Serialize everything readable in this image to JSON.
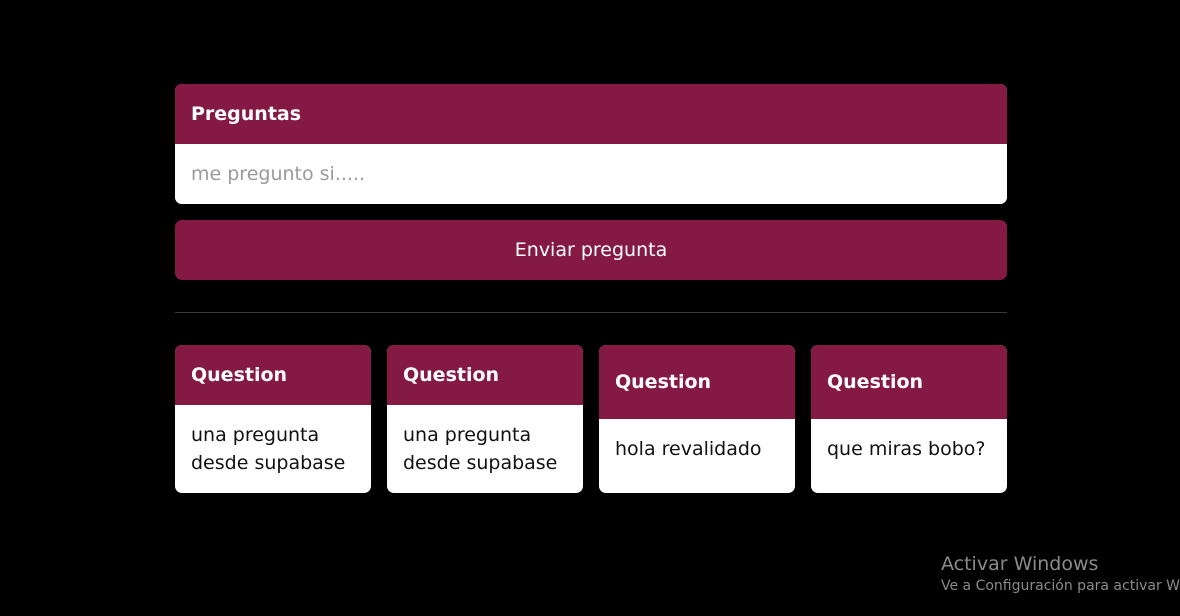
{
  "ask": {
    "header": "Preguntas",
    "placeholder": "me pregunto si.....",
    "submit_label": "Enviar pregunta"
  },
  "questions": [
    {
      "header": "Question",
      "text": "una pregunta desde supabase"
    },
    {
      "header": "Question",
      "text": "una pregunta desde supabase"
    },
    {
      "header": "Question",
      "text": "hola revalidado"
    },
    {
      "header": "Question",
      "text": "que miras bobo?"
    }
  ],
  "watermark": {
    "title": "Activar Windows",
    "subtitle": "Ve a Configuración para activar Windows."
  },
  "colors": {
    "background": "#000000",
    "accent": "#841a43",
    "card": "#ffffff",
    "divider": "#3a3a3a"
  }
}
